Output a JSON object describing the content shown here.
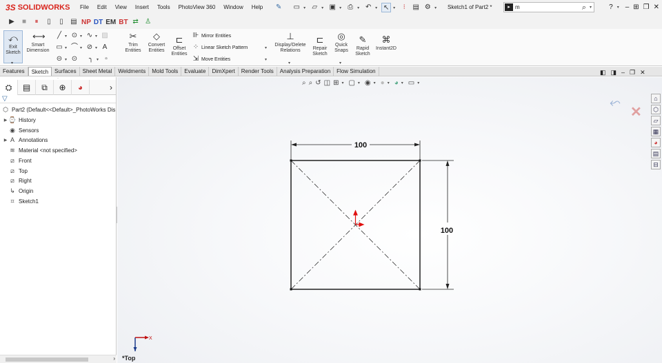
{
  "app": {
    "logo_ds": "3S",
    "logo_text": "SOLIDWORKS",
    "document_title": "Sketch1 of Part2 *",
    "search_value": "m"
  },
  "menu": [
    "File",
    "Edit",
    "View",
    "Insert",
    "Tools",
    "PhotoView 360",
    "Window",
    "Help"
  ],
  "macro_labels": [
    "NP",
    "DT",
    "EM",
    "BT"
  ],
  "ribbon": {
    "exit_sketch": "Exit Sketch",
    "smart_dimension": "Smart Dimension",
    "trim_entities": "Trim Entities",
    "convert_entities": "Convert Entities",
    "offset_entities": "Offset Entities",
    "mirror_entities": "Mirror Entities",
    "linear_sketch_pattern": "Linear Sketch Pattern",
    "move_entities": "Move Entities",
    "display_delete_relations": "Display/Delete Relations",
    "repair_sketch": "Repair Sketch",
    "quick_snaps": "Quick Snaps",
    "rapid_sketch": "Rapid Sketch",
    "instant2d": "Instant2D"
  },
  "tabs": [
    "Features",
    "Sketch",
    "Surfaces",
    "Sheet Metal",
    "Weldments",
    "Mold Tools",
    "Evaluate",
    "DimXpert",
    "Render Tools",
    "Analysis Preparation",
    "Flow Simulation"
  ],
  "selected_tab": "Sketch",
  "tree": {
    "root": "Part2  (Default<<Default>_PhotoWorks Dis",
    "items": [
      {
        "label": "History",
        "icon": "history-icon",
        "expandable": true
      },
      {
        "label": "Sensors",
        "icon": "sensors-icon",
        "expandable": false
      },
      {
        "label": "Annotations",
        "icon": "annotations-icon",
        "expandable": true
      },
      {
        "label": "Material <not specified>",
        "icon": "material-icon",
        "expandable": false
      },
      {
        "label": "Front",
        "icon": "plane-icon",
        "expandable": false
      },
      {
        "label": "Top",
        "icon": "plane-icon",
        "expandable": false
      },
      {
        "label": "Right",
        "icon": "plane-icon",
        "expandable": false
      },
      {
        "label": "Origin",
        "icon": "origin-icon",
        "expandable": false
      },
      {
        "label": "Sketch1",
        "icon": "sketch-icon",
        "expandable": false
      }
    ]
  },
  "sketch": {
    "dim_horizontal": "100",
    "dim_vertical": "100"
  },
  "view_name": "*Top",
  "triad_x_label": "X",
  "colors": {
    "brand_red": "#d9251d",
    "sketch_line": "#1a1a1a",
    "origin_red": "#e01010",
    "triad_blue": "#1a3a8a"
  }
}
